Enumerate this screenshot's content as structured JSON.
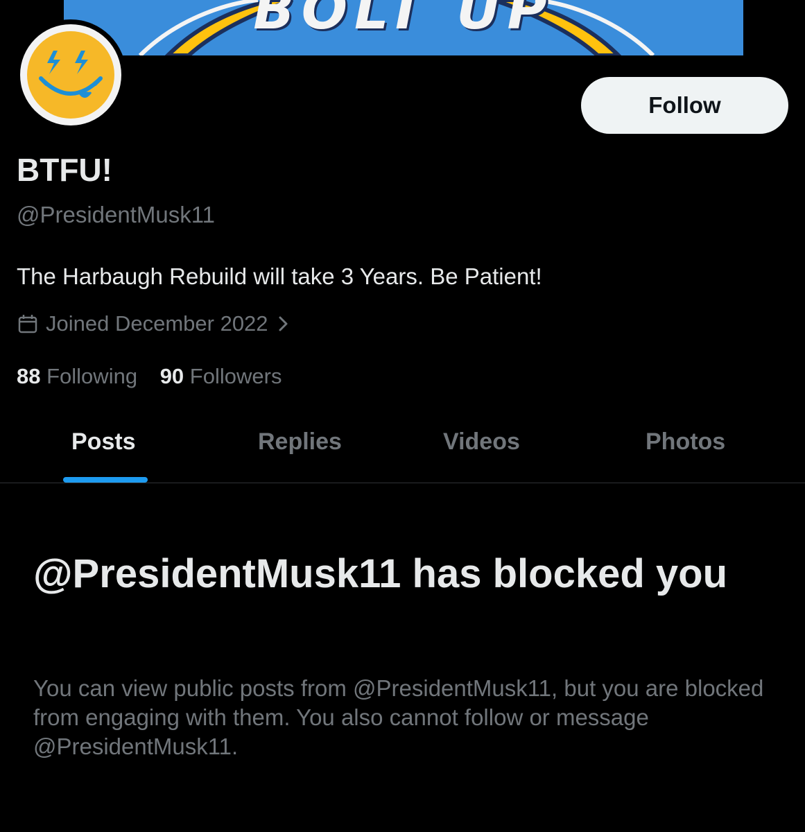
{
  "banner": {
    "text": "BOLT UP",
    "colors": {
      "background": "#3a8ddb",
      "bolt": "#ffc20e",
      "outline": "#1b2f5c"
    }
  },
  "avatar": {
    "icon": "smiley-face-icon",
    "colors": {
      "face": "#f6b828",
      "features": "#1d8fd6"
    }
  },
  "follow_button": {
    "label": "Follow"
  },
  "profile": {
    "display_name": "BTFU!",
    "handle": "@PresidentMusk11",
    "bio": "The Harbaugh Rebuild will take 3 Years. Be Patient!",
    "joined": "Joined December 2022",
    "following_count": "88",
    "following_label": "Following",
    "followers_count": "90",
    "followers_label": "Followers"
  },
  "tabs": [
    {
      "label": "Posts",
      "active": true
    },
    {
      "label": "Replies",
      "active": false
    },
    {
      "label": "Videos",
      "active": false
    },
    {
      "label": "Photos",
      "active": false
    }
  ],
  "blocked": {
    "title": "@PresidentMusk11 has blocked you",
    "description": "You can view public posts from @PresidentMusk11, but you are blocked from engaging with them. You also cannot follow or message @PresidentMusk11."
  },
  "colors": {
    "background": "#000000",
    "text_primary": "#e7e9ea",
    "text_secondary": "#71767b",
    "accent": "#1d9bf0",
    "divider": "#2f3336"
  }
}
